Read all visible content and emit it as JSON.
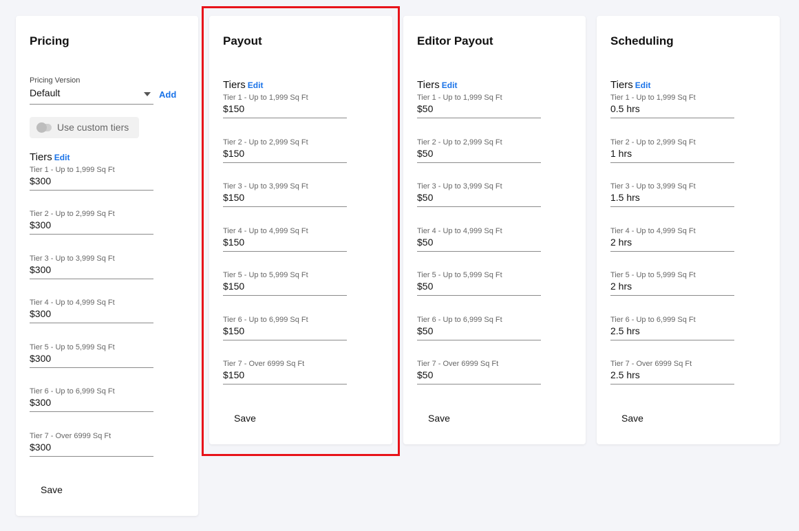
{
  "pricing": {
    "title": "Pricing",
    "pricing_version_label": "Pricing Version",
    "pricing_version_value": "Default",
    "add_label": "Add",
    "custom_tiers_label": "Use custom tiers",
    "tiers_label": "Tiers",
    "edit_label": "Edit",
    "save_label": "Save",
    "tiers": [
      {
        "label": "Tier 1 - Up to 1,999 Sq Ft",
        "value": "$300"
      },
      {
        "label": "Tier 2 - Up to 2,999 Sq Ft",
        "value": "$300"
      },
      {
        "label": "Tier 3 - Up to 3,999 Sq Ft",
        "value": "$300"
      },
      {
        "label": "Tier 4 - Up to 4,999 Sq Ft",
        "value": "$300"
      },
      {
        "label": "Tier 5 - Up to 5,999 Sq Ft",
        "value": "$300"
      },
      {
        "label": "Tier 6 - Up to 6,999 Sq Ft",
        "value": "$300"
      },
      {
        "label": "Tier 7 - Over 6999 Sq Ft",
        "value": "$300"
      }
    ]
  },
  "payout": {
    "title": "Payout",
    "tiers_label": "Tiers",
    "edit_label": "Edit",
    "save_label": "Save",
    "tiers": [
      {
        "label": "Tier 1 - Up to 1,999 Sq Ft",
        "value": "$150"
      },
      {
        "label": "Tier 2 - Up to 2,999 Sq Ft",
        "value": "$150"
      },
      {
        "label": "Tier 3 - Up to 3,999 Sq Ft",
        "value": "$150"
      },
      {
        "label": "Tier 4 - Up to 4,999 Sq Ft",
        "value": "$150"
      },
      {
        "label": "Tier 5 - Up to 5,999 Sq Ft",
        "value": "$150"
      },
      {
        "label": "Tier 6 - Up to 6,999 Sq Ft",
        "value": "$150"
      },
      {
        "label": "Tier 7 - Over 6999 Sq Ft",
        "value": "$150"
      }
    ]
  },
  "editor_payout": {
    "title": "Editor Payout",
    "tiers_label": "Tiers",
    "edit_label": "Edit",
    "save_label": "Save",
    "tiers": [
      {
        "label": "Tier 1 - Up to 1,999 Sq Ft",
        "value": "$50"
      },
      {
        "label": "Tier 2 - Up to 2,999 Sq Ft",
        "value": "$50"
      },
      {
        "label": "Tier 3 - Up to 3,999 Sq Ft",
        "value": "$50"
      },
      {
        "label": "Tier 4 - Up to 4,999 Sq Ft",
        "value": "$50"
      },
      {
        "label": "Tier 5 - Up to 5,999 Sq Ft",
        "value": "$50"
      },
      {
        "label": "Tier 6 - Up to 6,999 Sq Ft",
        "value": "$50"
      },
      {
        "label": "Tier 7 - Over 6999 Sq Ft",
        "value": "$50"
      }
    ]
  },
  "scheduling": {
    "title": "Scheduling",
    "tiers_label": "Tiers",
    "edit_label": "Edit",
    "save_label": "Save",
    "tiers": [
      {
        "label": "Tier 1 - Up to 1,999 Sq Ft",
        "value": "0.5 hrs"
      },
      {
        "label": "Tier 2 - Up to 2,999 Sq Ft",
        "value": "1 hrs"
      },
      {
        "label": "Tier 3 - Up to 3,999 Sq Ft",
        "value": "1.5 hrs"
      },
      {
        "label": "Tier 4 - Up to 4,999 Sq Ft",
        "value": "2 hrs"
      },
      {
        "label": "Tier 5 - Up to 5,999 Sq Ft",
        "value": "2 hrs"
      },
      {
        "label": "Tier 6 - Up to 6,999 Sq Ft",
        "value": "2.5 hrs"
      },
      {
        "label": "Tier 7 - Over 6999 Sq Ft",
        "value": "2.5 hrs"
      }
    ]
  },
  "colors": {
    "accent": "#1a73e8",
    "highlight": "#e8131a",
    "background": "#f4f5f9"
  }
}
